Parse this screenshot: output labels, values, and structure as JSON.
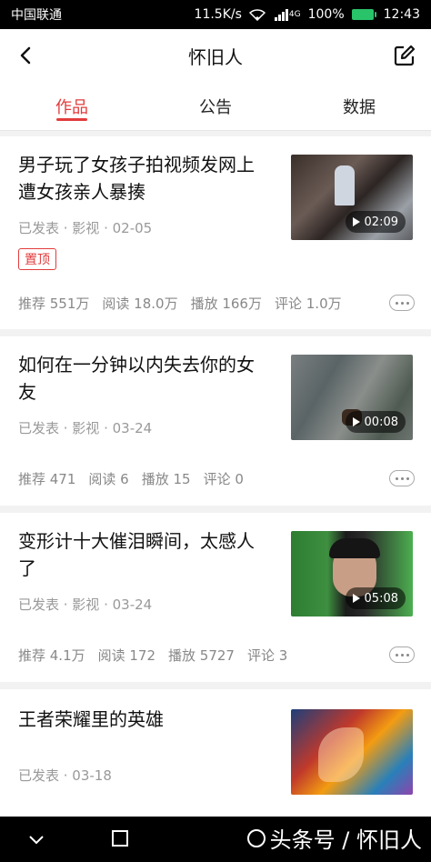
{
  "status_bar": {
    "carrier": "中国联通",
    "speed": "11.5K/s",
    "signal": "4G",
    "battery": "100%",
    "time": "12:43"
  },
  "header": {
    "title": "怀旧人",
    "back_icon": "back-arrow-icon",
    "edit_icon": "edit-icon"
  },
  "tabs": [
    {
      "label": "作品",
      "active": true
    },
    {
      "label": "公告",
      "active": false
    },
    {
      "label": "数据",
      "active": false
    }
  ],
  "items": [
    {
      "title_line1": "男子玩了女孩子拍视频发网上",
      "title_line2": "遭女孩亲人暴揍",
      "meta": "已发表 · 影视 · 02-05",
      "pin": "置顶",
      "duration": "02:09",
      "stats": [
        "推荐 551万",
        "阅读 18.0万",
        "播放 166万",
        "评论 1.0万"
      ]
    },
    {
      "title_line1": "如何在一分钟以内失去你的女",
      "title_line2": "友",
      "meta": "已发表 · 影视 · 03-24",
      "duration": "00:08",
      "stats": [
        "推荐 471",
        "阅读 6",
        "播放 15",
        "评论 0"
      ]
    },
    {
      "title_line1": "变形计十大催泪瞬间，太感人",
      "title_line2": "了",
      "meta": "已发表 · 影视 · 03-24",
      "duration": "05:08",
      "stats": [
        "推荐 4.1万",
        "阅读 172",
        "播放 5727",
        "评论 3"
      ]
    },
    {
      "title_line1": "王者荣耀里的英雄",
      "meta": "已发表 · 03-18"
    }
  ],
  "watermark": "头条号 / 怀旧人",
  "colors": {
    "accent": "#e23c3c",
    "battery": "#29c36a"
  }
}
